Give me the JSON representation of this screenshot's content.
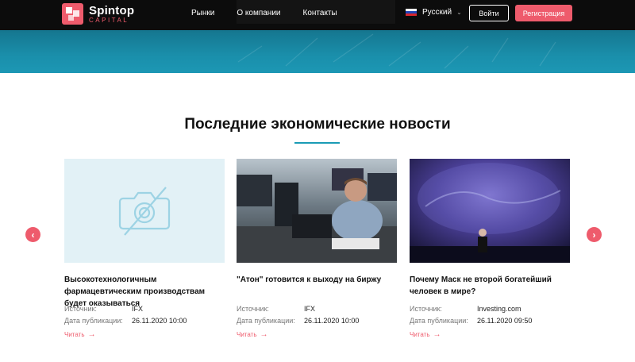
{
  "header": {
    "logo_name": "Spintop",
    "logo_sub": "CAPITAL",
    "nav": [
      "Рынки",
      "О компании",
      "Контакты"
    ],
    "language": "Русский",
    "login_label": "Войти",
    "register_label": "Регистрация"
  },
  "section": {
    "title": "Последние экономические новости"
  },
  "colors": {
    "accent": "#ee5b6c",
    "teal": "#1a8fab",
    "header_bg": "#0c0c0c"
  },
  "cards": [
    {
      "title": "Высокотехнологичным фармацевтическим производствам будет оказываться",
      "source_label": "Источник:",
      "source": "IFX",
      "date_label": "Дата публикации:",
      "date": "26.11.2020 10:00",
      "read_label": "Читать",
      "image_icon": "camera-off-icon"
    },
    {
      "title": "\"Атон\" готовится к выходу на биржу",
      "source_label": "Источник:",
      "source": "IFX",
      "date_label": "Дата публикации:",
      "date": "26.11.2020 10:00",
      "read_label": "Читать",
      "image_icon": "trading-floor-photo"
    },
    {
      "title": "Почему Маск не второй богатейший человек в мире?",
      "source_label": "Источник:",
      "source": "Investing.com",
      "date_label": "Дата публикации:",
      "date": "26.11.2020 09:50",
      "read_label": "Читать",
      "image_icon": "speaker-stage-photo"
    }
  ]
}
